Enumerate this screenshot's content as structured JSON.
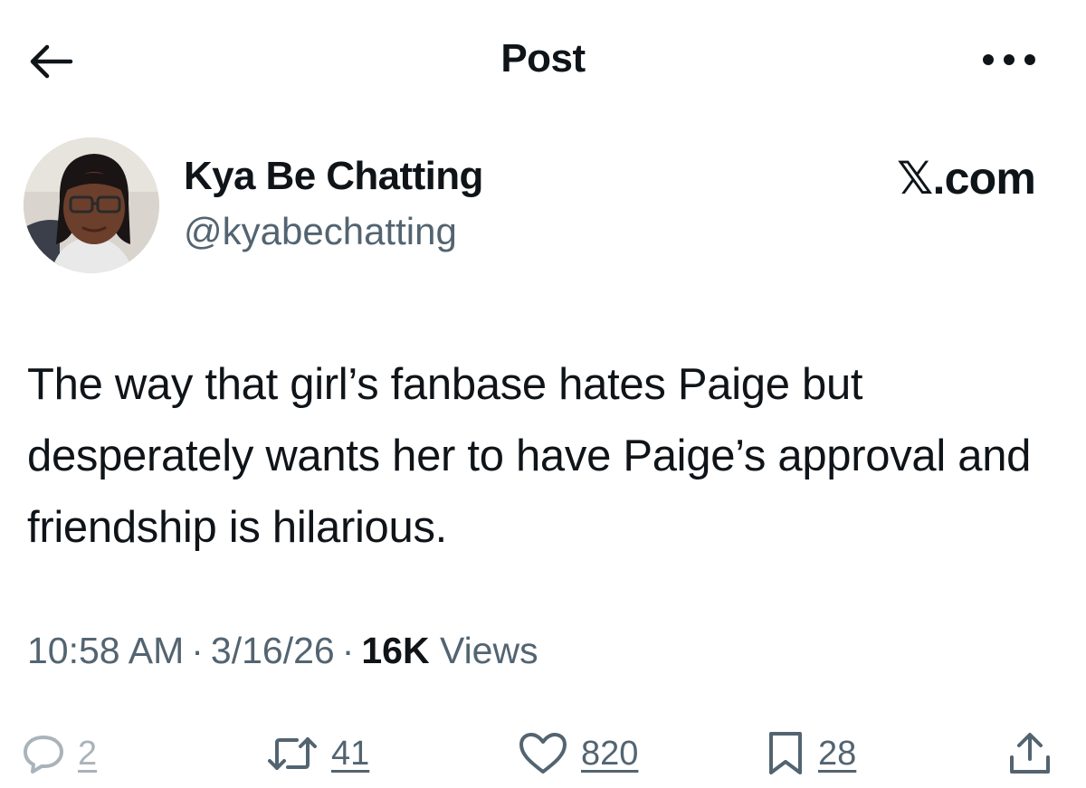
{
  "header": {
    "title": "Post",
    "back_icon": "arrow-left-icon",
    "more_icon": "more-horizontal-icon"
  },
  "author": {
    "display_name": "Kya Be Chatting",
    "handle": "@kyabechatting",
    "avatar_icon": "avatar-photo"
  },
  "source_label": "𝕏.com",
  "post": {
    "text": "The way that girl’s fanbase hates Paige but desperately wants her to have Paige’s approval and friendship is hilarious."
  },
  "meta": {
    "time": "10:58 AM",
    "date": "3/16/26",
    "views_count": "16K",
    "views_label": "Views",
    "separator": "·"
  },
  "actions": {
    "reply_count": "2",
    "repost_count": "41",
    "like_count": "820",
    "bookmark_count": "28"
  },
  "colors": {
    "text_primary": "#0f1419",
    "text_secondary": "#536471",
    "reply_muted": "#a9b3bb"
  }
}
